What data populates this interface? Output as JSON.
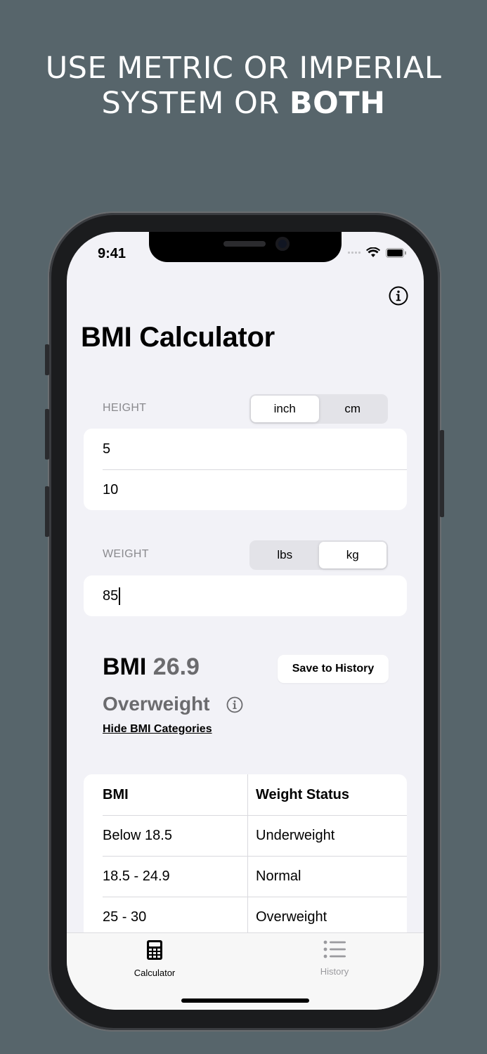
{
  "promo": {
    "line1": "USE METRIC OR IMPERIAL",
    "line2_prefix": "SYSTEM OR ",
    "line2_bold": "BOTH"
  },
  "status_bar": {
    "time": "9:41"
  },
  "screen": {
    "title": "BMI Calculator",
    "info_icon": "info-circle-icon"
  },
  "height": {
    "label": "HEIGHT",
    "units": [
      "inch",
      "cm"
    ],
    "selected": "inch",
    "values": [
      "5",
      "10"
    ]
  },
  "weight": {
    "label": "WEIGHT",
    "units": [
      "lbs",
      "kg"
    ],
    "selected": "kg",
    "value": "85"
  },
  "result": {
    "bmi_label": "BMI",
    "bmi_value": "26.9",
    "category": "Overweight",
    "toggle_link": "Hide BMI Categories",
    "save_button": "Save to History"
  },
  "categories_table": {
    "headers": [
      "BMI",
      "Weight Status"
    ],
    "rows": [
      [
        "Below 18.5",
        "Underweight"
      ],
      [
        "18.5 - 24.9",
        "Normal"
      ],
      [
        "25 - 30",
        "Overweight"
      ]
    ]
  },
  "tab_bar": {
    "tabs": [
      {
        "label": "Calculator",
        "icon": "calculator-icon",
        "active": true
      },
      {
        "label": "History",
        "icon": "list-icon",
        "active": false
      }
    ]
  },
  "colors": {
    "background": "#57656b",
    "screen": "#f2f2f7",
    "secondary_text": "#6b6b6e"
  }
}
